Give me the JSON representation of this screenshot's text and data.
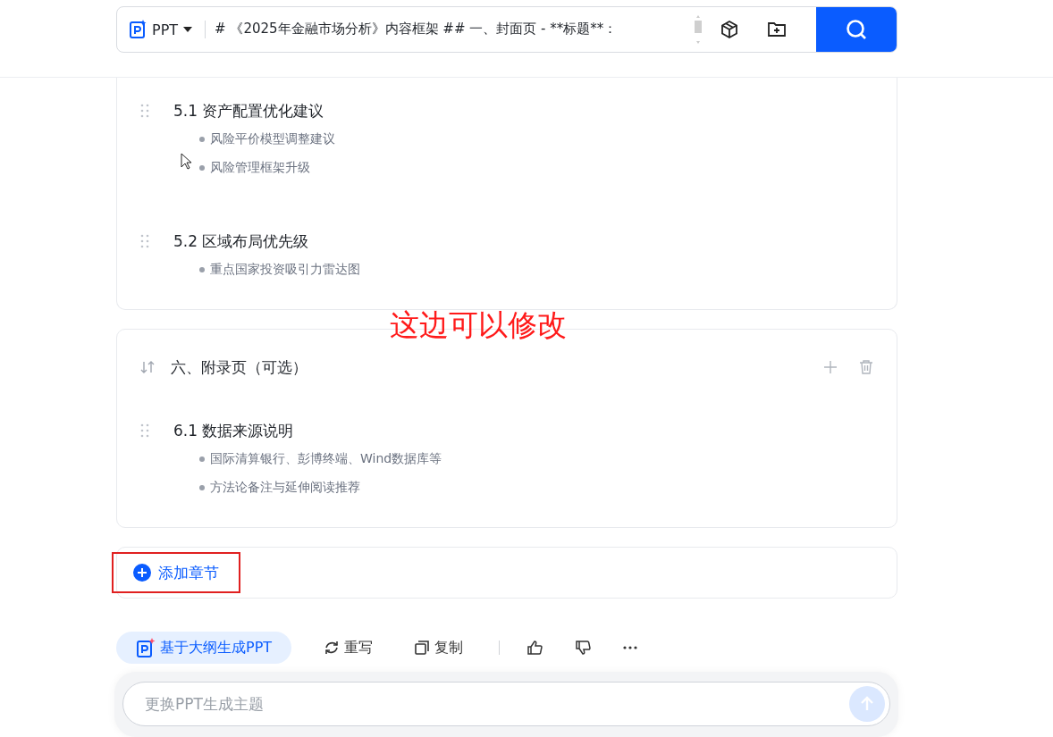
{
  "search_bar": {
    "mode": "PPT",
    "text_lines": [
      "# 《2025年金融市场分析》内容框架 ## 一、封面页 - **标题**："
    ]
  },
  "sections": [
    {
      "subsections": [
        {
          "title": "5.1 资产配置优化建议",
          "points": [
            "风险平价模型调整建议",
            "风险管理框架升级"
          ]
        },
        {
          "title": "5.2 区域布局优先级",
          "points": [
            "重点国家投资吸引力雷达图"
          ]
        }
      ]
    },
    {
      "title": "六、附录页（可选）",
      "subsections": [
        {
          "title": "6.1 数据来源说明",
          "points": [
            "国际清算银行、彭博终端、Wind数据库等",
            "方法论备注与延伸阅读推荐"
          ]
        }
      ]
    }
  ],
  "annotation_note": "这边可以修改",
  "add_section": {
    "label": "添加章节",
    "annotated": true
  },
  "actions": [
    {
      "kind": "primary",
      "label": "基于大纲生成PPT"
    },
    {
      "kind": "rewrite",
      "label": "重写"
    },
    {
      "kind": "copy",
      "label": "复制"
    },
    {
      "kind": "divider"
    },
    {
      "kind": "like"
    },
    {
      "kind": "dislike"
    },
    {
      "kind": "more"
    }
  ],
  "prompt_input": {
    "placeholder": "更换PPT生成主题",
    "send_disabled": true
  }
}
